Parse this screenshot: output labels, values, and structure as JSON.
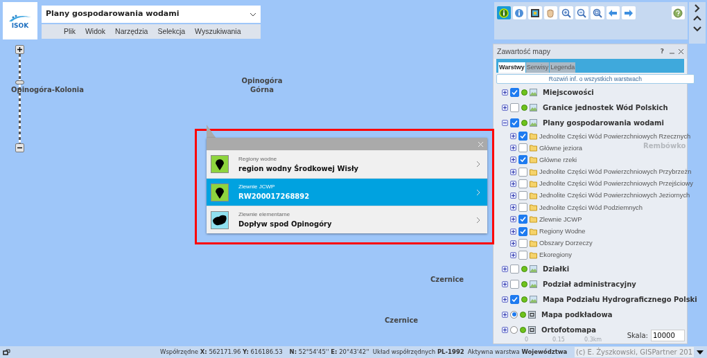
{
  "logo": {
    "text": "ISOK"
  },
  "theme_selector": {
    "value": "Plany gospodarowania wodami"
  },
  "menu": [
    "Plik",
    "Widok",
    "Narzędzia",
    "Selekcja",
    "Wyszukiwania"
  ],
  "map_labels": [
    "Opinogóra-Kolonia",
    "Opinogóra Górna",
    "Rembówko",
    "Czernice",
    "Czernice"
  ],
  "scale_bar": [
    "0",
    "0.15",
    "0.3km"
  ],
  "tools": [
    {
      "selected": true
    },
    {
      "selected": false
    },
    {
      "selected": false
    },
    {
      "selected": false
    },
    {
      "selected": false
    },
    {
      "selected": false
    },
    {
      "selected": false
    },
    {
      "selected": false
    },
    {
      "selected": false
    },
    {
      "selected": false
    }
  ],
  "popup": {
    "items": [
      {
        "kind": "marker",
        "category": "Regiony wodne",
        "value": "region wodny Środkowej Wisły",
        "selected": false
      },
      {
        "kind": "marker",
        "category": "Zlewnie JCWP",
        "value": "RW200017268892",
        "selected": true
      },
      {
        "kind": "polygon",
        "category": "Zlewnie elementarne",
        "value": "Dopływ spod Opinogóry",
        "selected": false
      }
    ]
  },
  "layers_panel": {
    "title": "Zawartość mapy",
    "help": "?",
    "tabs": [
      {
        "label": "Warstwy",
        "selected": true
      },
      {
        "label": "Serwisy",
        "selected": false
      },
      {
        "label": "Legenda",
        "selected": false
      }
    ],
    "expand_all": "Rozwiń inf. o wszystkich warstwach",
    "layers": [
      {
        "kind": "checkbox",
        "name": "Miejscowości",
        "checked": true,
        "expanded": false
      },
      {
        "kind": "checkbox",
        "name": "Granice jednostek Wód Polskich",
        "checked": false,
        "expanded": false
      },
      {
        "kind": "checkbox",
        "name": "Plany gospodarowania wodami",
        "checked": true,
        "expanded": true,
        "children": [
          {
            "name": "Jednolite Części Wód Powierzchniowych Rzecznych",
            "checked": true,
            "expanded": false
          },
          {
            "name": "Główne jeziora",
            "checked": false,
            "expanded": false
          },
          {
            "name": "Główne rzeki",
            "checked": true,
            "expanded": false
          },
          {
            "name": "Jednolite Części Wód Powierzchniowych Przybrzeżn",
            "checked": false,
            "expanded": false
          },
          {
            "name": "Jednolite Części Wód Powierzchniowych Przejściowy",
            "checked": false,
            "expanded": false
          },
          {
            "name": "Jednolite Części Wód Powierzchniowych Jeziornych",
            "checked": false,
            "expanded": false
          },
          {
            "name": "Jednolite Części Wód Podziemnych",
            "checked": false,
            "expanded": false
          },
          {
            "name": "Zlewnie JCWP",
            "checked": true,
            "expanded": false
          },
          {
            "name": "Regiony Wodne",
            "checked": true,
            "expanded": false
          },
          {
            "name": "Obszary Dorzeczy",
            "checked": false,
            "expanded": false
          },
          {
            "name": "Ekoregiony",
            "checked": false,
            "expanded": false
          }
        ]
      },
      {
        "kind": "checkbox",
        "name": "Działki",
        "checked": false,
        "expanded": false
      },
      {
        "kind": "checkbox",
        "name": "Podział administracyjny",
        "checked": false,
        "expanded": false
      },
      {
        "kind": "checkbox",
        "name": "Mapa Podziału Hydrograficznego Polski",
        "checked": true,
        "expanded": false
      },
      {
        "kind": "radio",
        "name": "Mapa podkładowa",
        "checked": true,
        "expanded": false
      },
      {
        "kind": "radio",
        "name": "Ortofotomapa",
        "checked": false,
        "expanded": false
      }
    ],
    "scale_label": "Skala:",
    "scale_value": "10000"
  },
  "status_bar": {
    "coords": "Współrzędne **X:** 562171.96 **Y:** 616186.53",
    "geo": "**N:** 52°54'45'' **E:** 20°43'42''",
    "system": "Układ współrzędnych **PL-1992**",
    "active_layer": "Aktywna warstwa **Województwa**",
    "copyright": "(c) E. Żyszkowski, GISPartner 201"
  }
}
